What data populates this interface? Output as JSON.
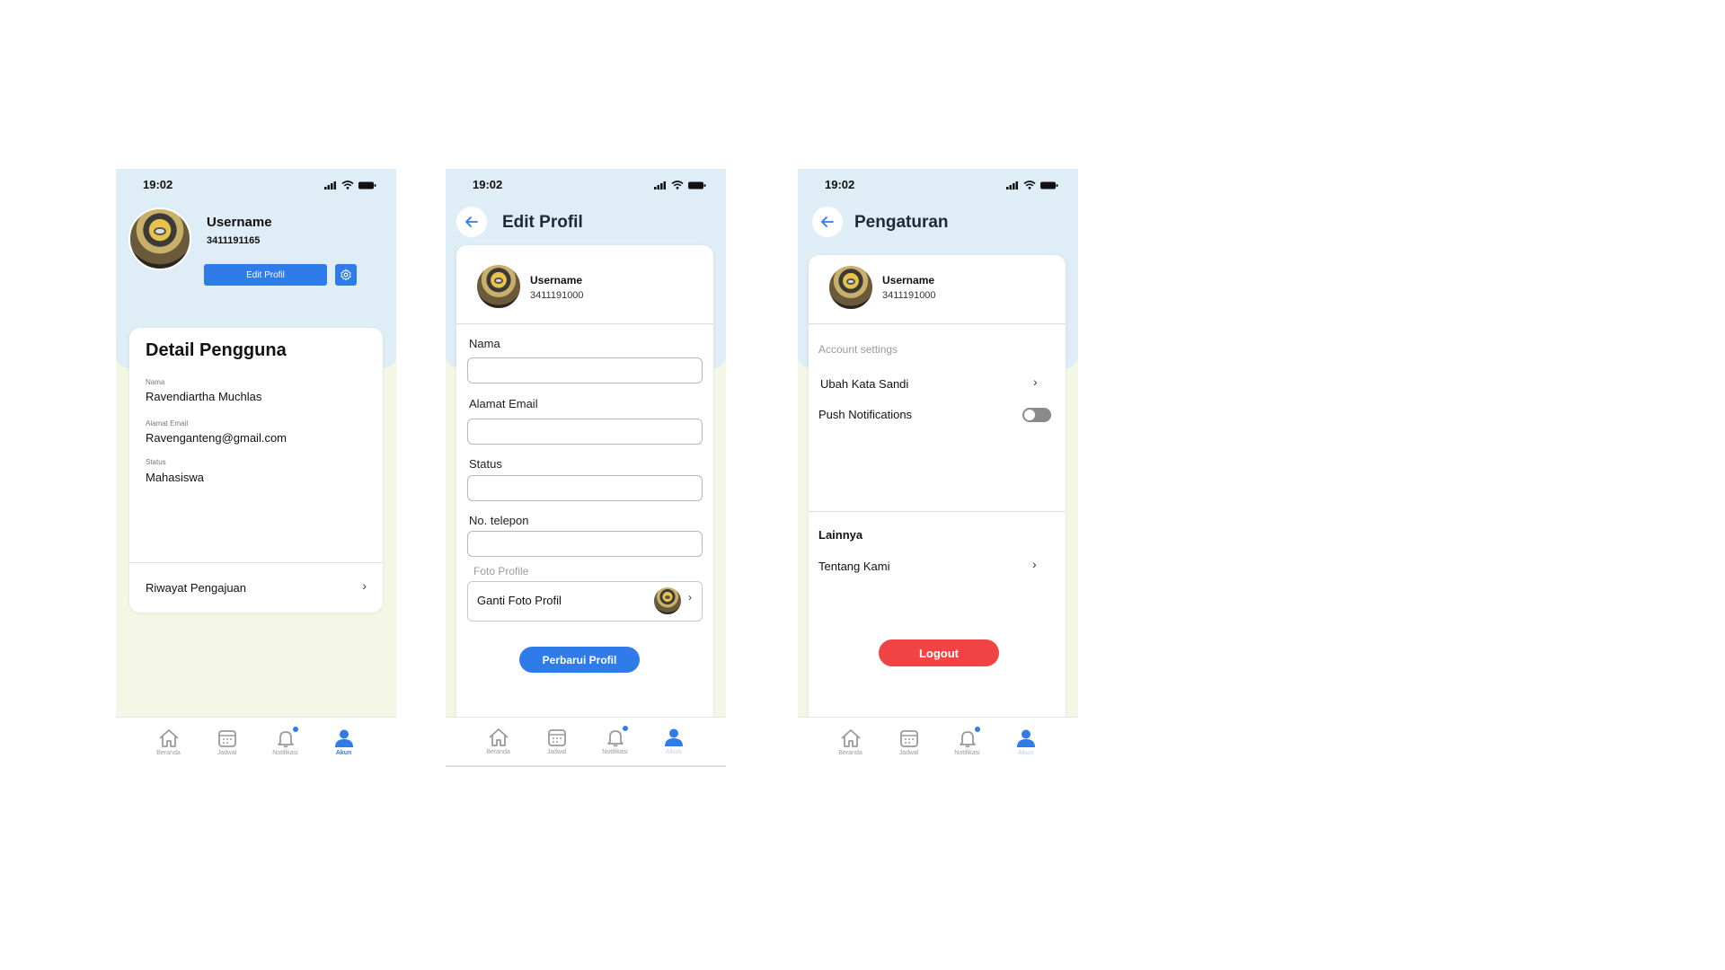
{
  "status_bar": {
    "time": "19:02"
  },
  "nav": {
    "items": [
      {
        "label": "Beranda",
        "icon": "home-icon"
      },
      {
        "label": "Jadwal",
        "icon": "calendar-icon"
      },
      {
        "label": "Notifikasi",
        "icon": "bell-icon"
      },
      {
        "label": "Akun",
        "icon": "user-icon"
      }
    ]
  },
  "profile_screen": {
    "username": "Username",
    "user_id": "3411191165",
    "edit_button": "Edit Profil",
    "detail_title": "Detail Pengguna",
    "fields": [
      {
        "label": "Nama",
        "value": "Ravendiartha Muchlas"
      },
      {
        "label": "Alamat Email",
        "value": "Ravenganteng@gmail.com"
      },
      {
        "label": "Status",
        "value": "Mahasiswa"
      }
    ],
    "history_item": "Riwayat Pengajuan"
  },
  "edit_screen": {
    "title": "Edit Profil",
    "username": "Username",
    "user_id": "3411191000",
    "fields": [
      {
        "label": "Nama",
        "value": ""
      },
      {
        "label": "Alamat Email",
        "value": ""
      },
      {
        "label": "Status",
        "value": ""
      },
      {
        "label": "No. telepon",
        "value": ""
      }
    ],
    "photo_section": "Foto Profile",
    "photo_item": "Ganti Foto Profil",
    "submit_button": "Perbarui Profil"
  },
  "settings_screen": {
    "title": "Pengaturan",
    "username": "Username",
    "user_id": "3411191000",
    "account_section": "Account settings",
    "change_password": "Ubah Kata Sandi",
    "push_notifications": "Push Notifications",
    "push_enabled": false,
    "other_section": "Lainnya",
    "about": "Tentang Kami",
    "logout_button": "Logout"
  },
  "colors": {
    "primary": "#2f7bea",
    "danger": "#f04444",
    "header_bg": "#dfedf7",
    "body_bg": "#f5f7e6"
  }
}
